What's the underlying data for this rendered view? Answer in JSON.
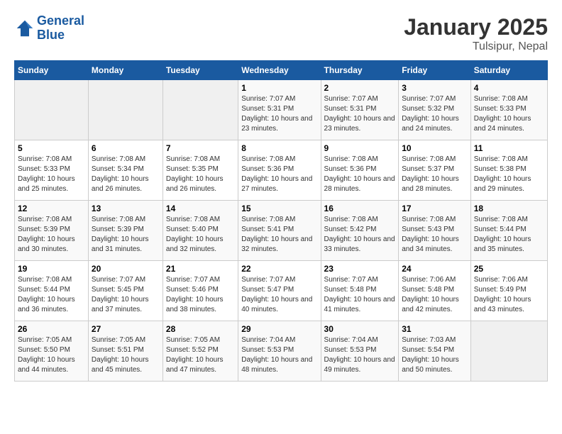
{
  "header": {
    "logo_line1": "General",
    "logo_line2": "Blue",
    "month": "January 2025",
    "location": "Tulsipur, Nepal"
  },
  "days_of_week": [
    "Sunday",
    "Monday",
    "Tuesday",
    "Wednesday",
    "Thursday",
    "Friday",
    "Saturday"
  ],
  "weeks": [
    [
      {
        "day": "",
        "sunrise": "",
        "sunset": "",
        "daylight": ""
      },
      {
        "day": "",
        "sunrise": "",
        "sunset": "",
        "daylight": ""
      },
      {
        "day": "",
        "sunrise": "",
        "sunset": "",
        "daylight": ""
      },
      {
        "day": "1",
        "sunrise": "Sunrise: 7:07 AM",
        "sunset": "Sunset: 5:31 PM",
        "daylight": "Daylight: 10 hours and 23 minutes."
      },
      {
        "day": "2",
        "sunrise": "Sunrise: 7:07 AM",
        "sunset": "Sunset: 5:31 PM",
        "daylight": "Daylight: 10 hours and 23 minutes."
      },
      {
        "day": "3",
        "sunrise": "Sunrise: 7:07 AM",
        "sunset": "Sunset: 5:32 PM",
        "daylight": "Daylight: 10 hours and 24 minutes."
      },
      {
        "day": "4",
        "sunrise": "Sunrise: 7:08 AM",
        "sunset": "Sunset: 5:33 PM",
        "daylight": "Daylight: 10 hours and 24 minutes."
      }
    ],
    [
      {
        "day": "5",
        "sunrise": "Sunrise: 7:08 AM",
        "sunset": "Sunset: 5:33 PM",
        "daylight": "Daylight: 10 hours and 25 minutes."
      },
      {
        "day": "6",
        "sunrise": "Sunrise: 7:08 AM",
        "sunset": "Sunset: 5:34 PM",
        "daylight": "Daylight: 10 hours and 26 minutes."
      },
      {
        "day": "7",
        "sunrise": "Sunrise: 7:08 AM",
        "sunset": "Sunset: 5:35 PM",
        "daylight": "Daylight: 10 hours and 26 minutes."
      },
      {
        "day": "8",
        "sunrise": "Sunrise: 7:08 AM",
        "sunset": "Sunset: 5:36 PM",
        "daylight": "Daylight: 10 hours and 27 minutes."
      },
      {
        "day": "9",
        "sunrise": "Sunrise: 7:08 AM",
        "sunset": "Sunset: 5:36 PM",
        "daylight": "Daylight: 10 hours and 28 minutes."
      },
      {
        "day": "10",
        "sunrise": "Sunrise: 7:08 AM",
        "sunset": "Sunset: 5:37 PM",
        "daylight": "Daylight: 10 hours and 28 minutes."
      },
      {
        "day": "11",
        "sunrise": "Sunrise: 7:08 AM",
        "sunset": "Sunset: 5:38 PM",
        "daylight": "Daylight: 10 hours and 29 minutes."
      }
    ],
    [
      {
        "day": "12",
        "sunrise": "Sunrise: 7:08 AM",
        "sunset": "Sunset: 5:39 PM",
        "daylight": "Daylight: 10 hours and 30 minutes."
      },
      {
        "day": "13",
        "sunrise": "Sunrise: 7:08 AM",
        "sunset": "Sunset: 5:39 PM",
        "daylight": "Daylight: 10 hours and 31 minutes."
      },
      {
        "day": "14",
        "sunrise": "Sunrise: 7:08 AM",
        "sunset": "Sunset: 5:40 PM",
        "daylight": "Daylight: 10 hours and 32 minutes."
      },
      {
        "day": "15",
        "sunrise": "Sunrise: 7:08 AM",
        "sunset": "Sunset: 5:41 PM",
        "daylight": "Daylight: 10 hours and 32 minutes."
      },
      {
        "day": "16",
        "sunrise": "Sunrise: 7:08 AM",
        "sunset": "Sunset: 5:42 PM",
        "daylight": "Daylight: 10 hours and 33 minutes."
      },
      {
        "day": "17",
        "sunrise": "Sunrise: 7:08 AM",
        "sunset": "Sunset: 5:43 PM",
        "daylight": "Daylight: 10 hours and 34 minutes."
      },
      {
        "day": "18",
        "sunrise": "Sunrise: 7:08 AM",
        "sunset": "Sunset: 5:44 PM",
        "daylight": "Daylight: 10 hours and 35 minutes."
      }
    ],
    [
      {
        "day": "19",
        "sunrise": "Sunrise: 7:08 AM",
        "sunset": "Sunset: 5:44 PM",
        "daylight": "Daylight: 10 hours and 36 minutes."
      },
      {
        "day": "20",
        "sunrise": "Sunrise: 7:07 AM",
        "sunset": "Sunset: 5:45 PM",
        "daylight": "Daylight: 10 hours and 37 minutes."
      },
      {
        "day": "21",
        "sunrise": "Sunrise: 7:07 AM",
        "sunset": "Sunset: 5:46 PM",
        "daylight": "Daylight: 10 hours and 38 minutes."
      },
      {
        "day": "22",
        "sunrise": "Sunrise: 7:07 AM",
        "sunset": "Sunset: 5:47 PM",
        "daylight": "Daylight: 10 hours and 40 minutes."
      },
      {
        "day": "23",
        "sunrise": "Sunrise: 7:07 AM",
        "sunset": "Sunset: 5:48 PM",
        "daylight": "Daylight: 10 hours and 41 minutes."
      },
      {
        "day": "24",
        "sunrise": "Sunrise: 7:06 AM",
        "sunset": "Sunset: 5:48 PM",
        "daylight": "Daylight: 10 hours and 42 minutes."
      },
      {
        "day": "25",
        "sunrise": "Sunrise: 7:06 AM",
        "sunset": "Sunset: 5:49 PM",
        "daylight": "Daylight: 10 hours and 43 minutes."
      }
    ],
    [
      {
        "day": "26",
        "sunrise": "Sunrise: 7:05 AM",
        "sunset": "Sunset: 5:50 PM",
        "daylight": "Daylight: 10 hours and 44 minutes."
      },
      {
        "day": "27",
        "sunrise": "Sunrise: 7:05 AM",
        "sunset": "Sunset: 5:51 PM",
        "daylight": "Daylight: 10 hours and 45 minutes."
      },
      {
        "day": "28",
        "sunrise": "Sunrise: 7:05 AM",
        "sunset": "Sunset: 5:52 PM",
        "daylight": "Daylight: 10 hours and 47 minutes."
      },
      {
        "day": "29",
        "sunrise": "Sunrise: 7:04 AM",
        "sunset": "Sunset: 5:53 PM",
        "daylight": "Daylight: 10 hours and 48 minutes."
      },
      {
        "day": "30",
        "sunrise": "Sunrise: 7:04 AM",
        "sunset": "Sunset: 5:53 PM",
        "daylight": "Daylight: 10 hours and 49 minutes."
      },
      {
        "day": "31",
        "sunrise": "Sunrise: 7:03 AM",
        "sunset": "Sunset: 5:54 PM",
        "daylight": "Daylight: 10 hours and 50 minutes."
      },
      {
        "day": "",
        "sunrise": "",
        "sunset": "",
        "daylight": ""
      }
    ]
  ]
}
